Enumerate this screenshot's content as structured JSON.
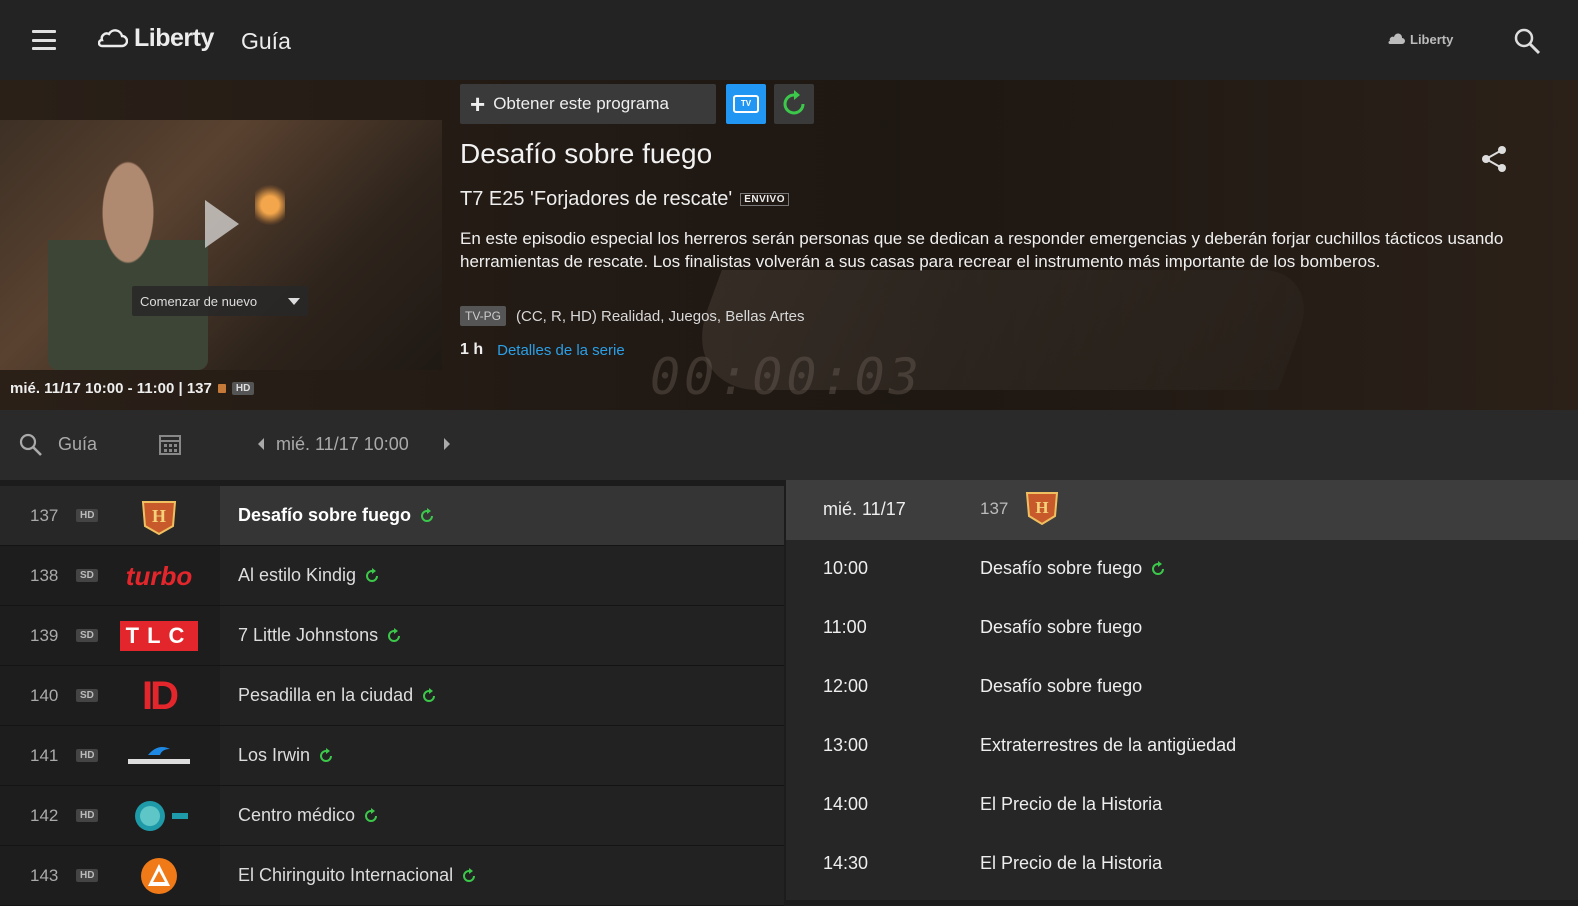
{
  "header": {
    "brand": "Liberty",
    "title": "Guía",
    "small_brand": "Liberty"
  },
  "hero": {
    "get_program_label": "Obtener este programa",
    "tv_label": "TV",
    "show_title": "Desafío sobre fuego",
    "episode": "T7 E25 'Forjadores de rescate'",
    "episode_tag": "ENVIVO",
    "description": "En este episodio especial los herreros serán personas que se dedican a responder emergencias y deberán forjar cuchillos tácticos usando herramientas de rescate. Los finalistas volverán a sus casas para recrear el instrumento más importante de los bomberos.",
    "rating": "TV-PG",
    "meta": "(CC, R, HD) Realidad, Juegos, Bellas Artes",
    "duration": "1 h",
    "series_link": "Detalles de la serie",
    "restart_label": "Comenzar de nuevo",
    "airing": "mié. 11/17 10:00 - 11:00 | 137",
    "airing_badge": "HD",
    "timer": "00:00:03"
  },
  "toolbar": {
    "guide_label": "Guía",
    "date": "mié. 11/17 10:00"
  },
  "channels": [
    {
      "num": "137",
      "quality": "HD",
      "logo": "history-logo",
      "program": "Desafío sobre fuego",
      "selected": true
    },
    {
      "num": "138",
      "quality": "SD",
      "logo": "turbo-logo",
      "program": "Al estilo Kindig",
      "selected": false
    },
    {
      "num": "139",
      "quality": "SD",
      "logo": "tlc-logo",
      "program": "7 Little Johnstons",
      "selected": false
    },
    {
      "num": "140",
      "quality": "SD",
      "logo": "id-logo",
      "program": "Pesadilla en la ciudad",
      "selected": false
    },
    {
      "num": "141",
      "quality": "HD",
      "logo": "animal-planet-logo",
      "program": "Los Irwin",
      "selected": false
    },
    {
      "num": "142",
      "quality": "HD",
      "logo": "discovery-home-health-logo",
      "program": "Centro médico",
      "selected": false
    },
    {
      "num": "143",
      "quality": "HD",
      "logo": "antena3-logo",
      "program": "El Chiringuito Internacional",
      "selected": false
    }
  ],
  "channel_logo_text": {
    "turbo": "turbo",
    "tlc": "TLC",
    "id": "ID"
  },
  "schedule": {
    "date": "mié. 11/17",
    "channel": "137",
    "items": [
      {
        "time": "10:00",
        "title": "Desafío sobre fuego",
        "rec": true
      },
      {
        "time": "11:00",
        "title": "Desafío sobre fuego",
        "rec": false
      },
      {
        "time": "12:00",
        "title": "Desafío sobre fuego",
        "rec": false
      },
      {
        "time": "13:00",
        "title": "Extraterrestres de la antigüedad",
        "rec": false
      },
      {
        "time": "14:00",
        "title": "El Precio de la Historia",
        "rec": false
      },
      {
        "time": "14:30",
        "title": "El Precio de la Historia",
        "rec": false
      }
    ]
  },
  "colors": {
    "accent_blue": "#2196f3",
    "link_blue": "#2aa0e8",
    "rec_green": "#3cc84a"
  }
}
